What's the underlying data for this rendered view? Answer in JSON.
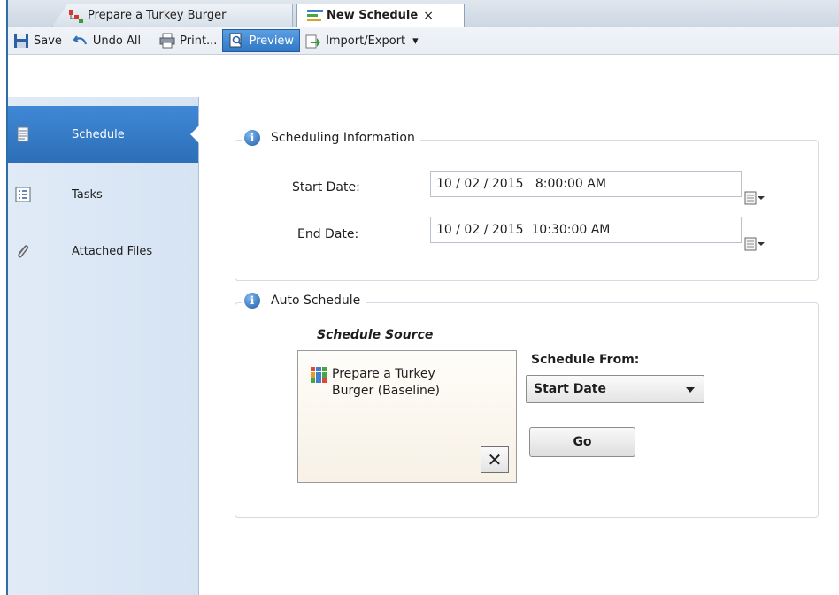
{
  "tabs": [
    {
      "label": "Prepare a Turkey Burger",
      "icon": "project-icon",
      "active": false
    },
    {
      "label": "New Schedule",
      "icon": "schedule-icon",
      "active": true,
      "close": "×"
    }
  ],
  "toolbar": {
    "save_label": "Save",
    "undo_label": "Undo All",
    "print_label": "Print...",
    "preview_label": "Preview",
    "import_export_label": "Import/Export",
    "dropdown_glyph": "▾"
  },
  "sidebar": {
    "items": [
      {
        "label": "Schedule",
        "icon": "schedule-doc-icon",
        "selected": true
      },
      {
        "label": "Tasks",
        "icon": "tasks-list-icon",
        "selected": false
      },
      {
        "label": "Attached Files",
        "icon": "paperclip-icon",
        "selected": false
      }
    ]
  },
  "scheduling": {
    "title": "Scheduling Information",
    "start_label": "Start Date:",
    "start_value": "10 / 02 / 2015   8:00:00 AM",
    "end_label": "End Date:",
    "end_value": "10 / 02 / 2015  10:30:00 AM"
  },
  "auto": {
    "title": "Auto Schedule",
    "source_heading": "Schedule Source",
    "source_item_line1": "Prepare a Turkey",
    "source_item_line2": "Burger (Baseline)",
    "remove_glyph": "✕",
    "from_label": "Schedule From:",
    "from_value": "Start Date",
    "go_label": "Go"
  },
  "colors": {
    "accent": "#2f78c8",
    "sidebar_bg": "#dbe7f5",
    "border": "#d3dbe4"
  }
}
